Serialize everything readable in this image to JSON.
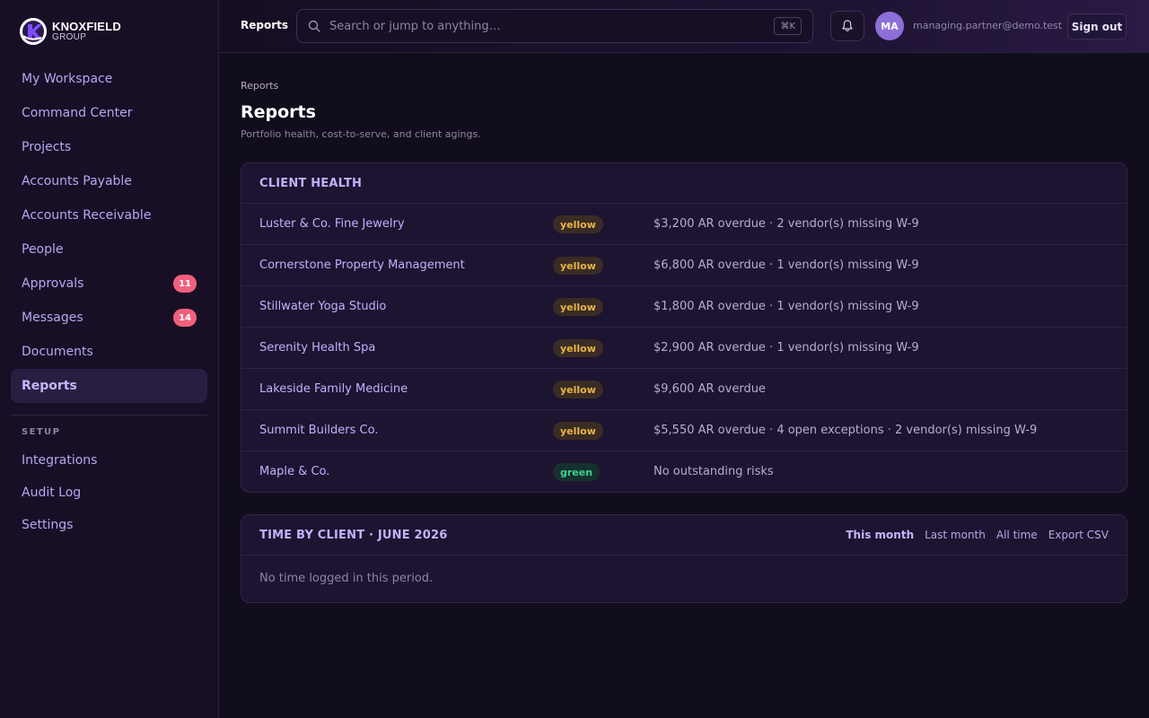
{
  "brand": {
    "name": "KNOXFIELD",
    "sub": "GROUP"
  },
  "sidebar": {
    "items": [
      {
        "label": "My Workspace"
      },
      {
        "label": "Command Center"
      },
      {
        "label": "Projects"
      },
      {
        "label": "Accounts Payable"
      },
      {
        "label": "Accounts Receivable"
      },
      {
        "label": "People"
      },
      {
        "label": "Approvals",
        "badge": "11"
      },
      {
        "label": "Messages",
        "badge": "14"
      },
      {
        "label": "Documents"
      },
      {
        "label": "Reports",
        "active": true
      }
    ],
    "setup_label": "SETUP",
    "setup_items": [
      {
        "label": "Integrations"
      },
      {
        "label": "Audit Log"
      },
      {
        "label": "Settings"
      }
    ]
  },
  "topbar": {
    "title": "Reports",
    "search_placeholder": "Search or jump to anything…",
    "search_shortcut": "⌘K",
    "avatar_initials": "MA",
    "user_email": "managing.partner@demo.test",
    "signout_label": "Sign out"
  },
  "page": {
    "breadcrumb": "Reports",
    "title": "Reports",
    "subtitle": "Portfolio health, cost-to-serve, and client agings."
  },
  "client_health": {
    "title": "CLIENT HEALTH",
    "rows": [
      {
        "client": "Luster & Co. Fine Jewelry",
        "status": "yellow",
        "risk": "$3,200 AR overdue · 2 vendor(s) missing W-9"
      },
      {
        "client": "Cornerstone Property Management",
        "status": "yellow",
        "risk": "$6,800 AR overdue · 1 vendor(s) missing W-9"
      },
      {
        "client": "Stillwater Yoga Studio",
        "status": "yellow",
        "risk": "$1,800 AR overdue · 1 vendor(s) missing W-9"
      },
      {
        "client": "Serenity Health Spa",
        "status": "yellow",
        "risk": "$2,900 AR overdue · 1 vendor(s) missing W-9"
      },
      {
        "client": "Lakeside Family Medicine",
        "status": "yellow",
        "risk": "$9,600 AR overdue"
      },
      {
        "client": "Summit Builders Co.",
        "status": "yellow",
        "risk": "$5,550 AR overdue · 4 open exceptions · 2 vendor(s) missing W-9"
      },
      {
        "client": "Maple & Co.",
        "status": "green",
        "risk": "No outstanding risks"
      }
    ]
  },
  "time_by_client": {
    "title": "TIME BY CLIENT · JUNE 2026",
    "tabs": [
      {
        "label": "This month",
        "active": true
      },
      {
        "label": "Last month"
      },
      {
        "label": "All time"
      },
      {
        "label": "Export CSV"
      }
    ],
    "empty_text": "No time logged in this period."
  },
  "colors": {
    "accent": "#c3b0ff",
    "badge": "#f0607c",
    "yellow_text": "#e8b447",
    "green_text": "#3fcf8e"
  }
}
